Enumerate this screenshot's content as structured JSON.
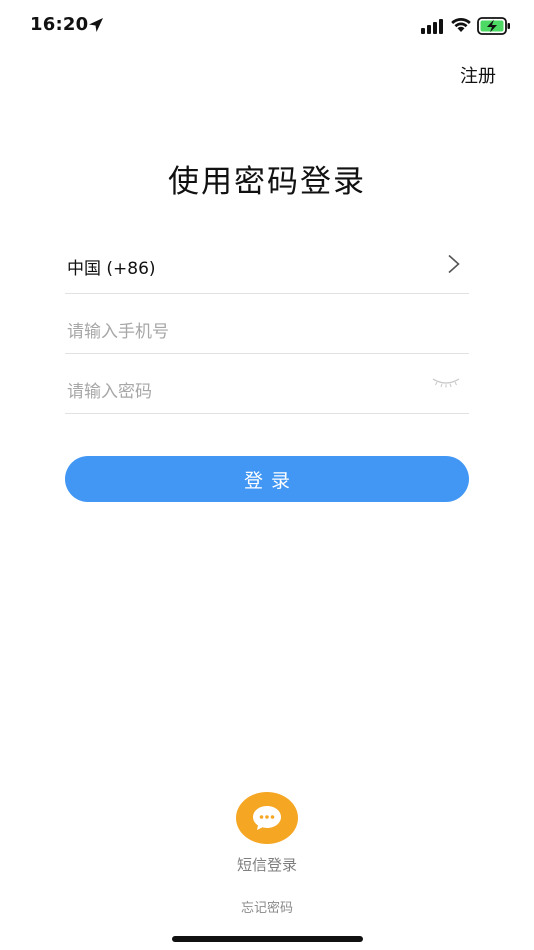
{
  "status_bar": {
    "time": "16:20",
    "icons": [
      "location-arrow-icon",
      "cellular-signal-icon",
      "wifi-icon",
      "battery-charging-icon"
    ]
  },
  "header": {
    "register_label": "注册"
  },
  "page": {
    "title": "使用密码登录"
  },
  "form": {
    "country": {
      "value": "中国 (+86)",
      "icon": "chevron-right-icon"
    },
    "phone": {
      "placeholder": "请输入手机号",
      "value": ""
    },
    "password": {
      "placeholder": "请输入密码",
      "value": "",
      "icon": "eye-closed-icon"
    },
    "login_label": "登录"
  },
  "alternatives": {
    "sms_label": "短信登录",
    "sms_icon": "chat-bubble-icon",
    "forgot_label": "忘记密码"
  },
  "colors": {
    "primary": "#4297f4",
    "sms_accent": "#f5a623",
    "placeholder": "#a7a7a7",
    "divider": "#e2e2e2"
  }
}
